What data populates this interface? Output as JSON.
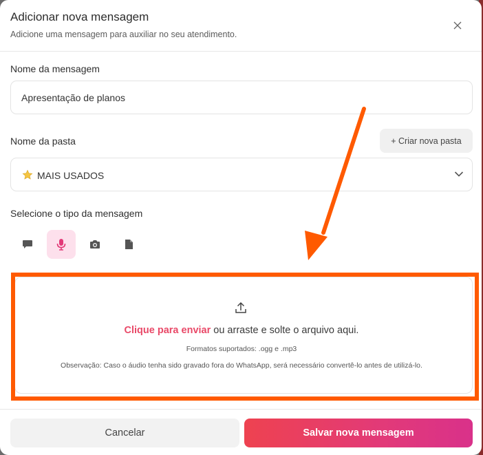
{
  "modal": {
    "title": "Adicionar nova mensagem",
    "subtitle": "Adicione uma mensagem para auxiliar no seu atendimento."
  },
  "form": {
    "message_name_label": "Nome da mensagem",
    "message_name_value": "Apresentação de planos",
    "folder_label": "Nome da pasta",
    "new_folder_button": "+ Criar nova pasta",
    "folder_selected": "MAIS USADOS",
    "type_label": "Selecione o tipo da mensagem",
    "types": [
      {
        "icon": "chat-bubble-icon",
        "active": false
      },
      {
        "icon": "microphone-icon",
        "active": true
      },
      {
        "icon": "camera-icon",
        "active": false
      },
      {
        "icon": "document-icon",
        "active": false
      }
    ]
  },
  "dropzone": {
    "link_text": "Clique para enviar",
    "rest_text": " ou arraste e solte o arquivo aqui.",
    "formats": "Formatos suportados: .ogg e .mp3",
    "note": "Observação: Caso o áudio tenha sido gravado fora do WhatsApp, será necessário convertê-lo antes de utilizá-lo."
  },
  "footer": {
    "cancel_label": "Cancelar",
    "save_label": "Salvar nova mensagem"
  },
  "colors": {
    "accent": "#e94968",
    "active_bg": "#fde0ec",
    "annotation": "#ff5a00"
  }
}
